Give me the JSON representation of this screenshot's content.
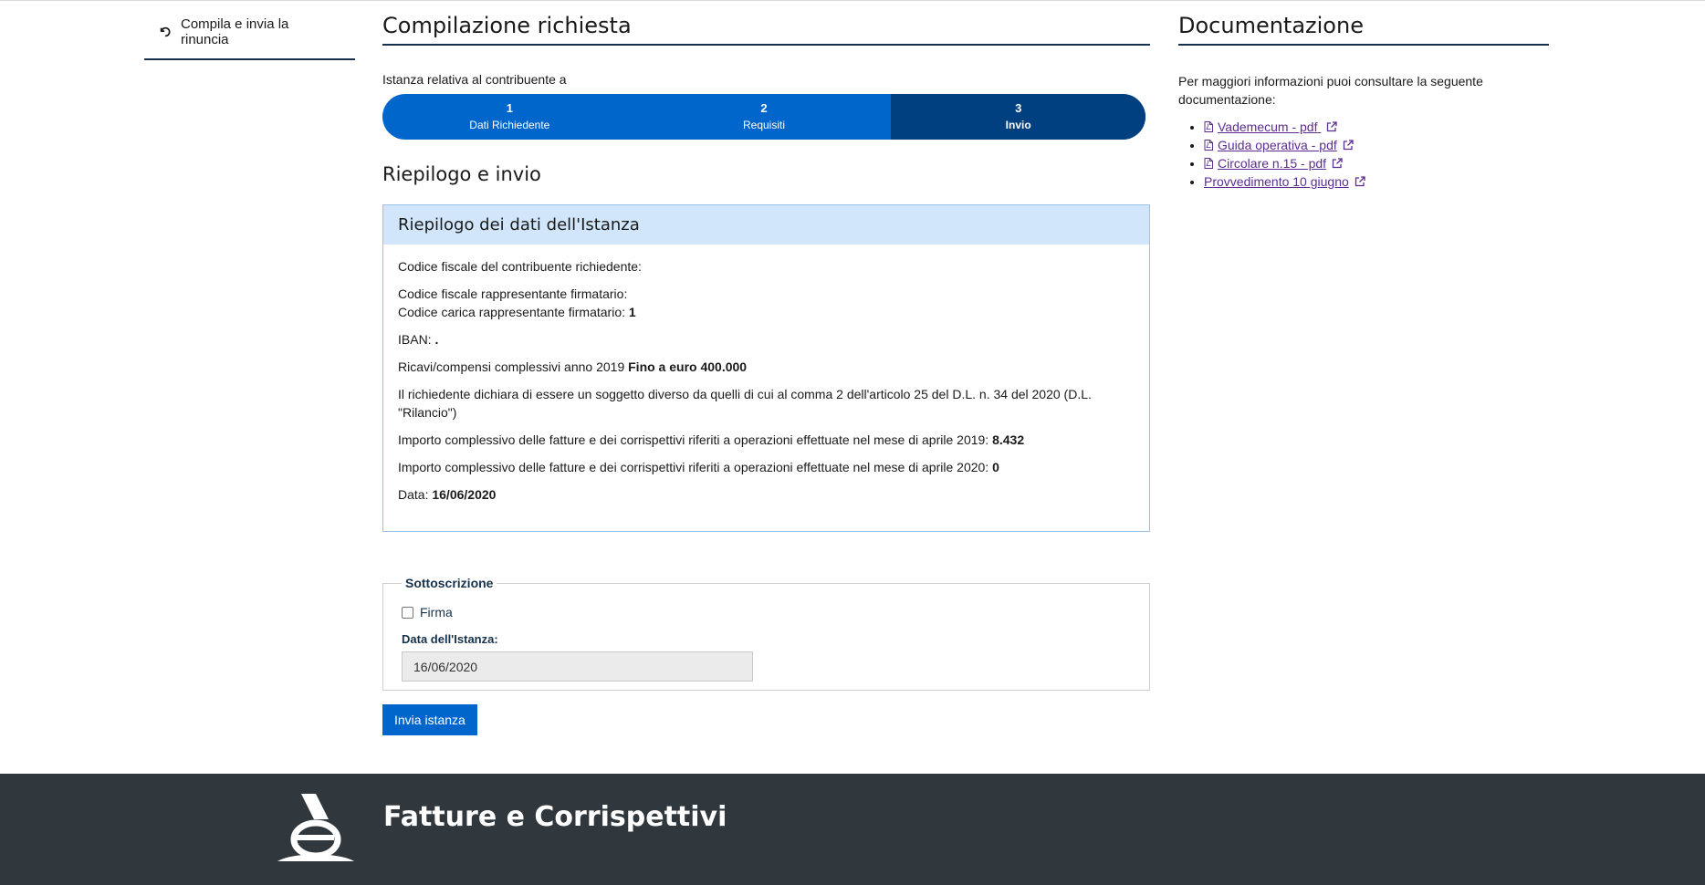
{
  "leftnav": {
    "item_label": "Compila e invia la rinuncia"
  },
  "main": {
    "title": "Compilazione richiesta",
    "intro": "Istanza relativa al contribuente a",
    "steps": [
      {
        "num": "1",
        "label": "Dati Richiedente"
      },
      {
        "num": "2",
        "label": "Requisiti"
      },
      {
        "num": "3",
        "label": "Invio"
      }
    ],
    "summary_title": "Riepilogo e invio",
    "panel": {
      "title": "Riepilogo dei dati dell'Istanza",
      "cf_richiedente": "Codice fiscale del contribuente richiedente:",
      "cf_rappresentante": "Codice fiscale rappresentante firmatario:",
      "codice_carica_label": "Codice carica rappresentante firmatario:",
      "codice_carica_value": "1",
      "iban_label": "IBAN:",
      "iban_value": ".",
      "ricavi_label": "Ricavi/compensi complessivi anno 2019",
      "ricavi_value": "Fino a euro 400.000",
      "dichiarazione": "Il richiedente dichiara di essere un soggetto diverso da quelli di cui al comma 2 dell'articolo 25 del D.L. n. 34 del 2020 (D.L. \"Rilancio\")",
      "importo_2019_label": "Importo complessivo delle fatture e dei corrispettivi riferiti a operazioni effettuate nel mese di aprile 2019:",
      "importo_2019_value": "8.432",
      "importo_2020_label": "Importo complessivo delle fatture e dei corrispettivi riferiti a operazioni effettuate nel mese di aprile 2020:",
      "importo_2020_value": "0",
      "data_label": "Data:",
      "data_value": "16/06/2020"
    },
    "subscription": {
      "legend": "Sottoscrizione",
      "firma_label": "Firma",
      "date_label": "Data dell'Istanza:",
      "date_value": "16/06/2020"
    },
    "submit_label": "Invia istanza"
  },
  "side": {
    "title": "Documentazione",
    "desc": "Per maggiori informazioni puoi consultare la seguente documentazione:",
    "docs": [
      {
        "label": "Vademecum - pdf ",
        "icon": "pdf-icon"
      },
      {
        "label": "Guida operativa - pdf",
        "icon": "pdf-icon"
      },
      {
        "label": "Circolare n.15 - pdf",
        "icon": "pdf-icon"
      },
      {
        "label": "Provvedimento 10 giugno",
        "icon": "none"
      }
    ]
  },
  "footer": {
    "title": "Fatture e Corrispettivi"
  },
  "colors": {
    "primary": "#0066cc",
    "primary_dark": "#004080",
    "panel_head": "#d1e6fa",
    "footer": "#30373d",
    "link_visited": "#5c2d91"
  }
}
